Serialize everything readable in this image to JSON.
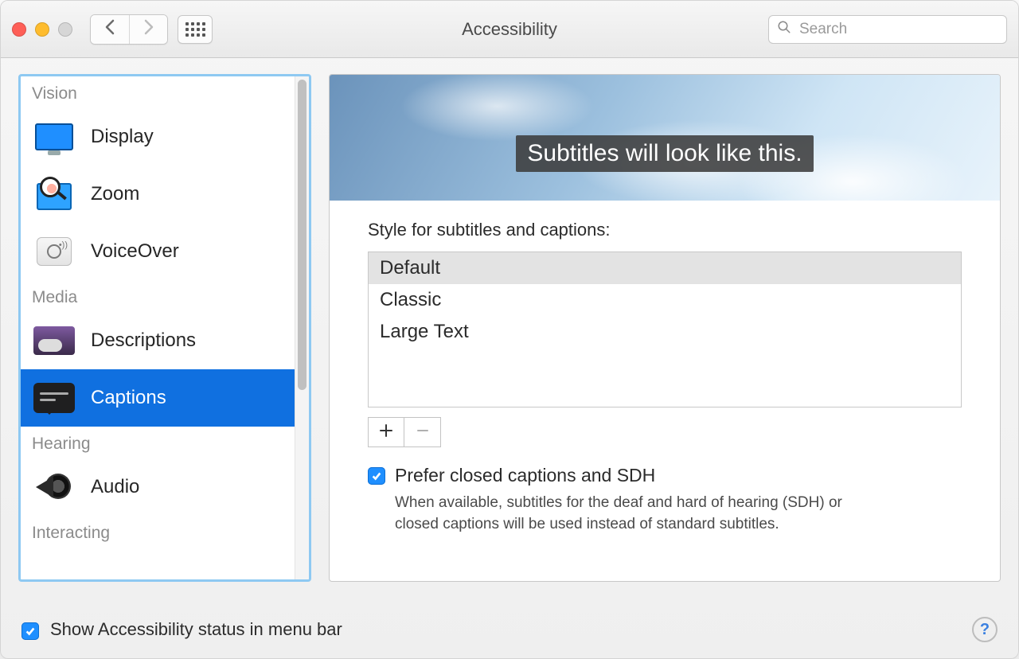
{
  "window": {
    "title": "Accessibility"
  },
  "toolbar": {
    "search_placeholder": "Search"
  },
  "sidebar": {
    "groups": [
      {
        "label": "Vision",
        "items": [
          {
            "id": "display",
            "label": "Display",
            "selected": false
          },
          {
            "id": "zoom",
            "label": "Zoom",
            "selected": false
          },
          {
            "id": "voiceover",
            "label": "VoiceOver",
            "selected": false
          }
        ]
      },
      {
        "label": "Media",
        "items": [
          {
            "id": "descriptions",
            "label": "Descriptions",
            "selected": false
          },
          {
            "id": "captions",
            "label": "Captions",
            "selected": true
          }
        ]
      },
      {
        "label": "Hearing",
        "items": [
          {
            "id": "audio",
            "label": "Audio",
            "selected": false
          }
        ]
      },
      {
        "label": "Interacting",
        "items": []
      }
    ]
  },
  "captions": {
    "preview_text": "Subtitles will look like this.",
    "style_label": "Style for subtitles and captions:",
    "styles": [
      {
        "name": "Default",
        "selected": true
      },
      {
        "name": "Classic",
        "selected": false
      },
      {
        "name": "Large Text",
        "selected": false
      }
    ],
    "prefer_sdh": {
      "checked": true,
      "label": "Prefer closed captions and SDH",
      "help": "When available, subtitles for the deaf and hard of hearing (SDH) or closed captions will be used instead of standard subtitles."
    }
  },
  "footer": {
    "show_status": {
      "checked": true,
      "label": "Show Accessibility status in menu bar"
    }
  },
  "colors": {
    "accent": "#1f8fff",
    "selection": "#1070e0"
  }
}
